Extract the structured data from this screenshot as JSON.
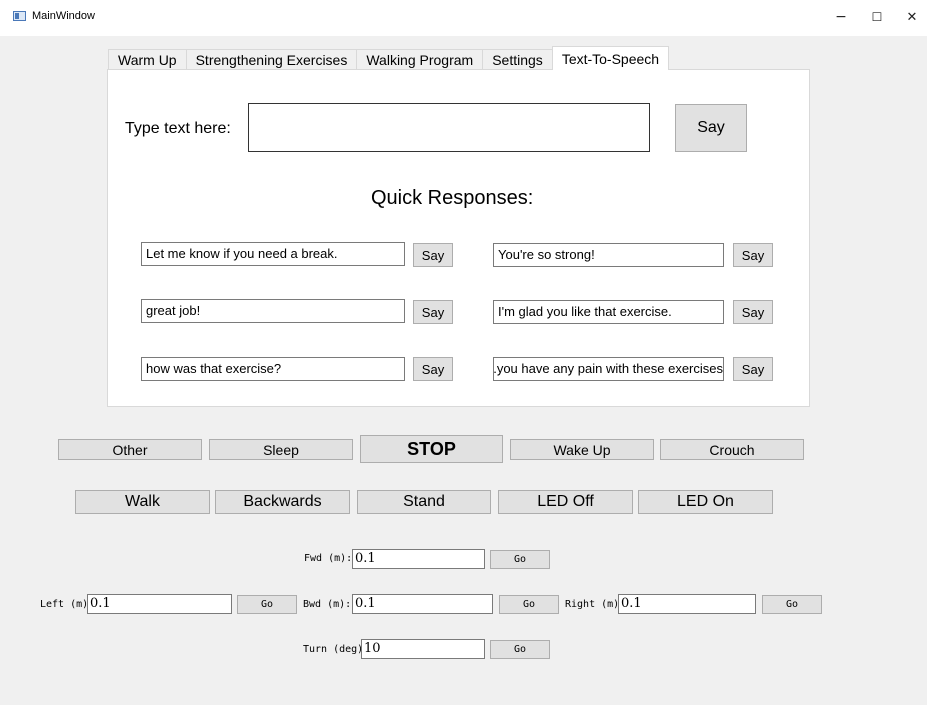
{
  "window": {
    "title": "MainWindow",
    "minimize": "−",
    "maximize": "☐",
    "close": "✕"
  },
  "tabs": [
    "Warm Up",
    "Strengthening Exercises",
    "Walking Program",
    "Settings",
    "Text-To-Speech"
  ],
  "active_tab": "Text-To-Speech",
  "tts": {
    "prompt_label": "Type text here:",
    "input_value": "",
    "say_label": "Say",
    "quick_title": "Quick Responses:",
    "quick": [
      {
        "text": "Let me know if you need a break.",
        "say": "Say"
      },
      {
        "text": "You're so strong!",
        "say": "Say"
      },
      {
        "text": "great job!",
        "say": "Say"
      },
      {
        "text": "I'm glad you like that exercise.",
        "say": "Say"
      },
      {
        "text": "how was that exercise?",
        "say": "Say"
      },
      {
        "text": "you have any pain with these exercises.",
        "say": "Say"
      }
    ]
  },
  "commands_row1": [
    "Other",
    "Sleep",
    "STOP",
    "Wake Up",
    "Crouch"
  ],
  "commands_row2": [
    "Walk",
    "Backwards",
    "Stand",
    "LED Off",
    "LED On"
  ],
  "movement": {
    "fwd_label": "Fwd (m):",
    "fwd_value": "0.1",
    "left_label": "Left (m):",
    "left_value": "0.1",
    "bwd_label": "Bwd (m):",
    "bwd_value": "0.1",
    "right_label": "Right (m):",
    "right_value": "0.1",
    "turn_label": "Turn (deg):",
    "turn_value": "10",
    "go_label": "Go"
  }
}
